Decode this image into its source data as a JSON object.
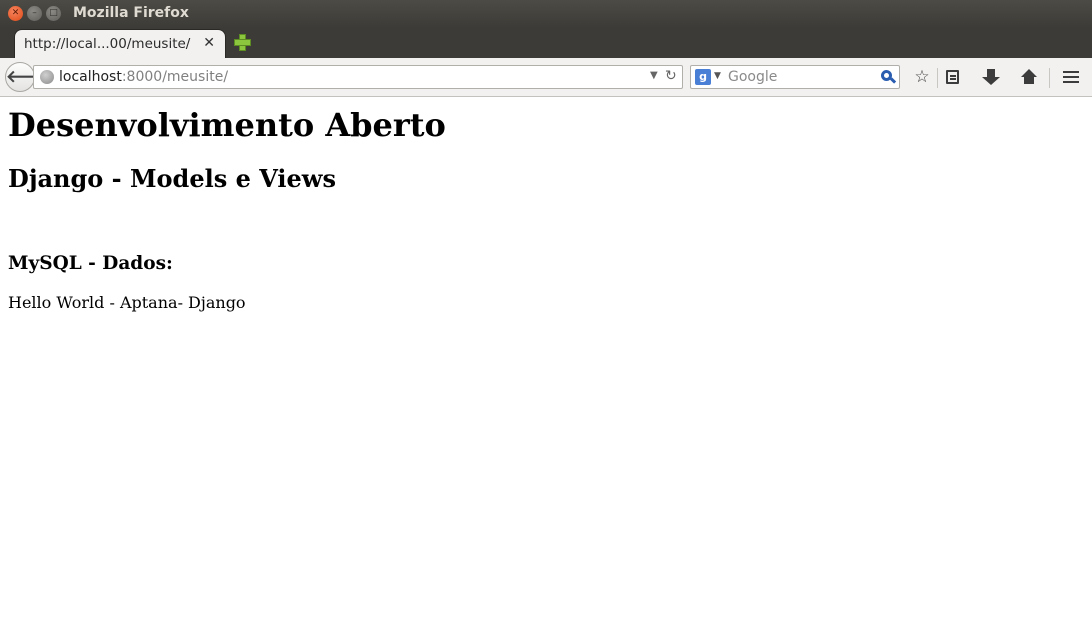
{
  "window": {
    "title": "Mozilla Firefox"
  },
  "tabs": [
    {
      "label": "http://local...00/meusite/",
      "close_glyph": "✕"
    }
  ],
  "navbar": {
    "url_host": "localhost",
    "url_rest": ":8000/meusite/",
    "search_placeholder": "Google",
    "search_engine_letter": "g"
  },
  "page": {
    "heading1": "Desenvolvimento Aberto",
    "heading2": "Django - Models e Views",
    "heading3": "MySQL - Dados:",
    "paragraph": "Hello World - Aptana- Django"
  },
  "colors": {
    "titlebar": "#3c3b37",
    "close_button": "#df4a16",
    "newtab_plus": "#8cc63f",
    "search_lens": "#2a5db0"
  },
  "icons": [
    "close-icon",
    "minimize-icon",
    "maximize-icon",
    "new-tab-icon",
    "back-arrow-icon",
    "globe-icon",
    "chevron-down-icon",
    "reload-icon",
    "google-icon",
    "search-icon",
    "bookmark-star-icon",
    "reading-list-icon",
    "download-icon",
    "home-icon",
    "menu-icon"
  ]
}
